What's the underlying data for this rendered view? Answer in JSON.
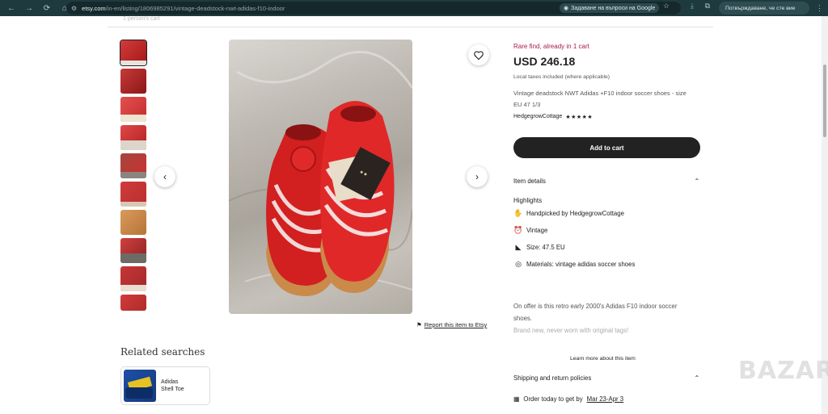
{
  "browser": {
    "url_host": "etsy.com",
    "url_path": "/in-en/listing/1806985291/vintage-deadstock-nwt-adidas-f10-indoor",
    "google_chip": "Задаване на въпроси на Google",
    "profile_label": "Потвърждаване, че сте вие"
  },
  "listing": {
    "top_faint": "1 person's cart",
    "rare_find": "Rare find, already in 1 cart",
    "price": "USD 246.18",
    "tax_note": "Local taxes included (where applicable)",
    "title": "Vintage deadstock NWT Adidas +F10 indoor soccer shoes - size EU 47 1/3",
    "seller": "HedgegrowCottage",
    "stars": "★★★★★",
    "add_to_cart": "Add to cart",
    "report_label": "Report this item to Etsy"
  },
  "item_details": {
    "header": "Item details",
    "highlights_title": "Highlights",
    "highlights": [
      {
        "icon": "hand-icon",
        "label": "Handpicked by HedgegrowCottage"
      },
      {
        "icon": "clock-icon",
        "label": "Vintage"
      },
      {
        "icon": "ruler-icon",
        "label": "Size: 47.5 EU"
      },
      {
        "icon": "material-icon",
        "label": "Materials: vintage adidas soccer shoes"
      }
    ],
    "desc_line1": "On offer is this retro early 2000's Adidas F10 indoor soccer shoes.",
    "desc_line2": "Brand new, never worn with original tags!",
    "learn_more": "Learn more about this item"
  },
  "shipping": {
    "header": "Shipping and return policies",
    "order_prefix": "Order today to get by",
    "order_date": "Mar 23-Apr 3"
  },
  "related": {
    "title": "Related searches",
    "items": [
      {
        "label_line1": "Adidas",
        "label_line2": "Shell Toe"
      }
    ]
  },
  "watermark": "BAZAR"
}
